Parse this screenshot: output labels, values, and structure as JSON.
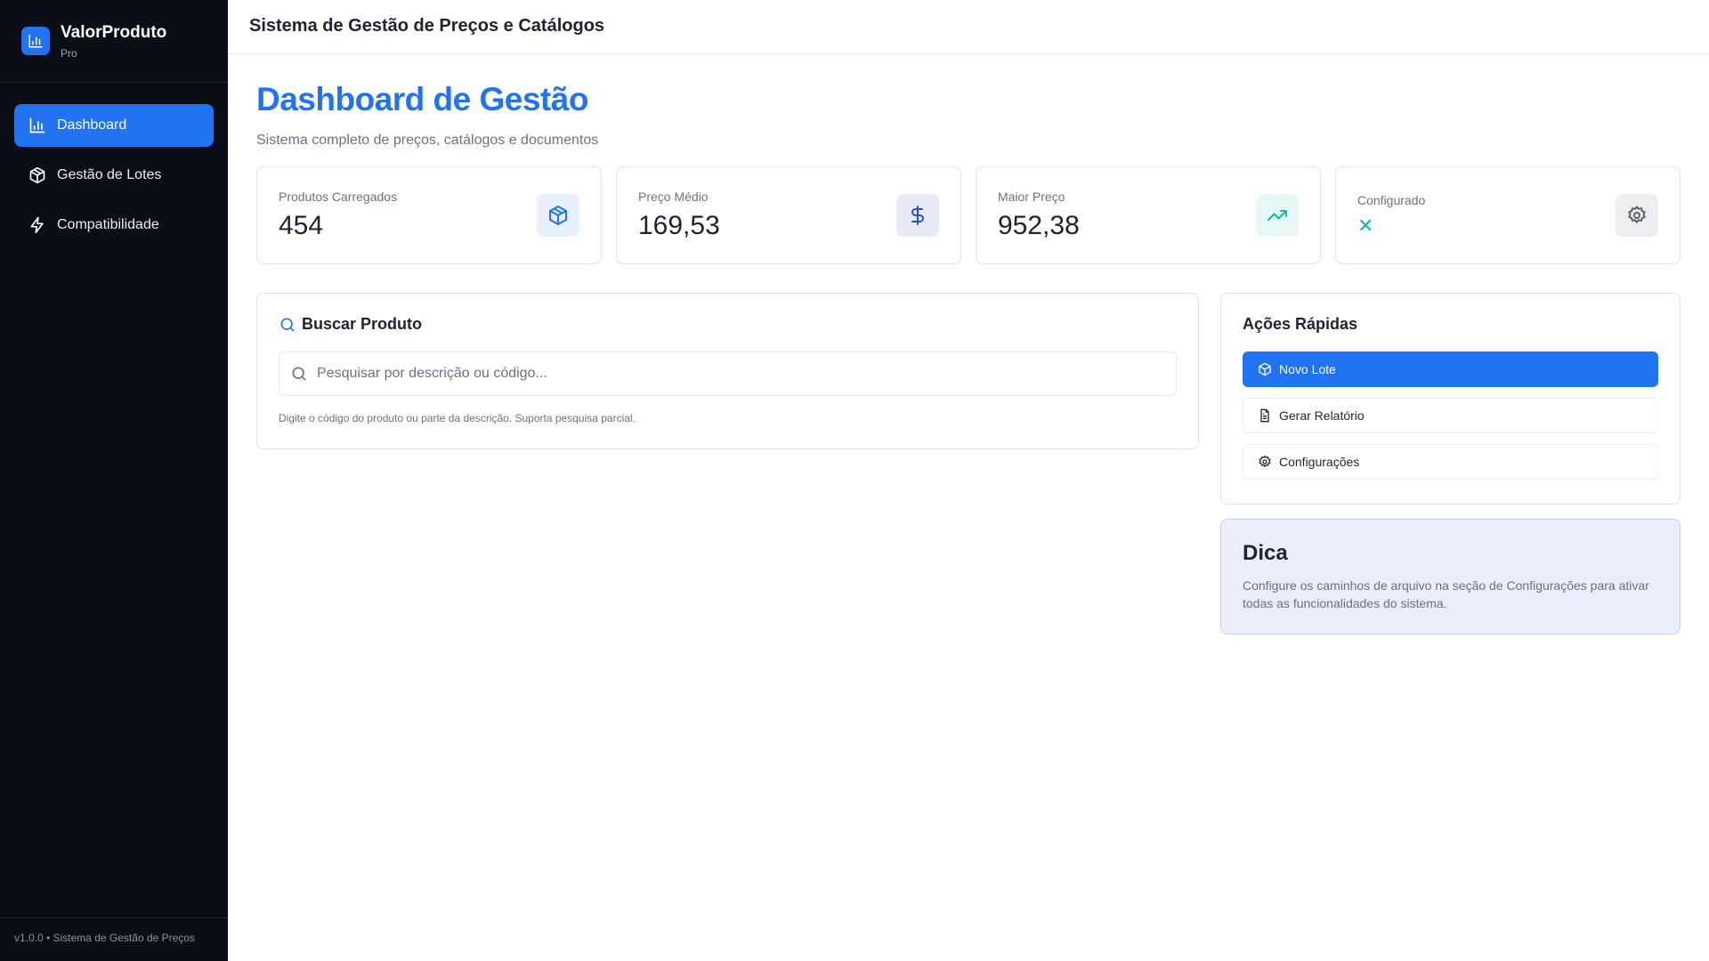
{
  "app": {
    "name": "ValorProduto",
    "tier": "Pro",
    "version_footer": "v1.0.0 • Sistema de Gestão de Preços"
  },
  "sidebar": {
    "items": [
      {
        "label": "Dashboard",
        "icon": "bar-chart-icon",
        "active": true
      },
      {
        "label": "Gestão de Lotes",
        "icon": "package-icon"
      },
      {
        "label": "Compatibilidade",
        "icon": "zap-icon"
      }
    ]
  },
  "header": {
    "title": "Sistema de Gestão de Preços e Catálogos"
  },
  "page": {
    "title": "Dashboard de Gestão",
    "subtitle": "Sistema completo de preços, catálogos e documentos"
  },
  "stats": [
    {
      "label": "Produtos Carregados",
      "value": "454",
      "icon": "package-icon"
    },
    {
      "label": "Preço Médio",
      "value": "169,53",
      "icon": "dollar-icon"
    },
    {
      "label": "Maior Preço",
      "value": "952,38",
      "icon": "trending-up-icon"
    },
    {
      "label": "Configurado",
      "value": "✕",
      "icon": "gear-icon"
    }
  ],
  "search": {
    "title": "Buscar Produto",
    "placeholder": "Pesquisar por descrição ou código...",
    "hint": "Digite o código do produto ou parte da descrição. Suporta pesquisa parcial."
  },
  "quick_actions": {
    "title": "Ações Rápidas",
    "buttons": [
      "Novo Lote",
      "Gerar Relatório",
      "Configurações"
    ]
  },
  "tip": {
    "title": "Dica",
    "text": "Configure os caminhos de arquivo na seção de Configurações para ativar todas as funcionalidades do sistema."
  },
  "colors": {
    "accent": "#2273f1",
    "sidebar": "#0b0e17",
    "teal": "#14b8a6"
  }
}
